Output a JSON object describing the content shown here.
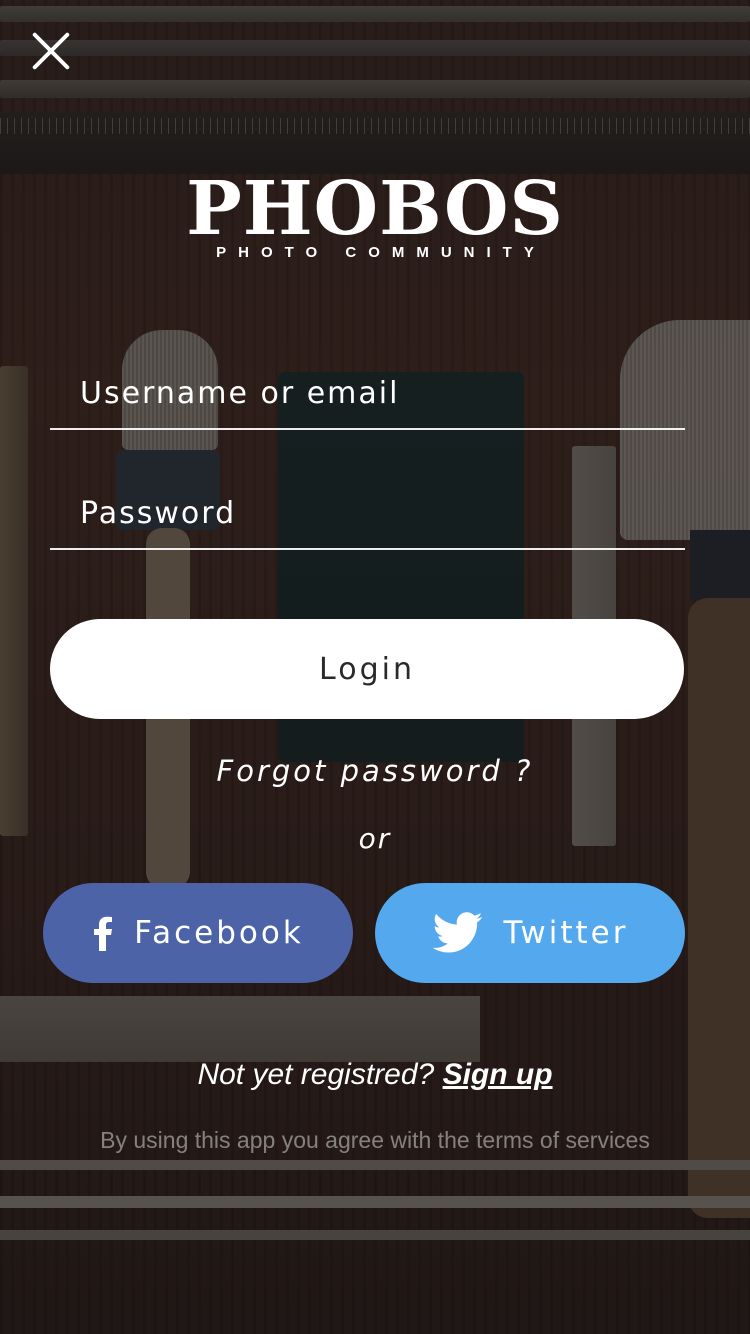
{
  "logo": {
    "title": "PHOBOS",
    "tagline": "PHOTO COMMUNITY"
  },
  "form": {
    "username_placeholder": "Username or email",
    "password_placeholder": "Password",
    "login_label": "Login",
    "forgot_label": "Forgot password ?",
    "or_label": "or"
  },
  "social": {
    "facebook_label": "Facebook",
    "facebook_icon": "facebook-icon",
    "facebook_color": "#4d63a8",
    "twitter_label": "Twitter",
    "twitter_icon": "twitter-bird-icon",
    "twitter_color": "#53a8ee"
  },
  "signup": {
    "prompt": "Not yet registred?",
    "link_label": "Sign up"
  },
  "terms": "By using this app you agree with the terms of services"
}
